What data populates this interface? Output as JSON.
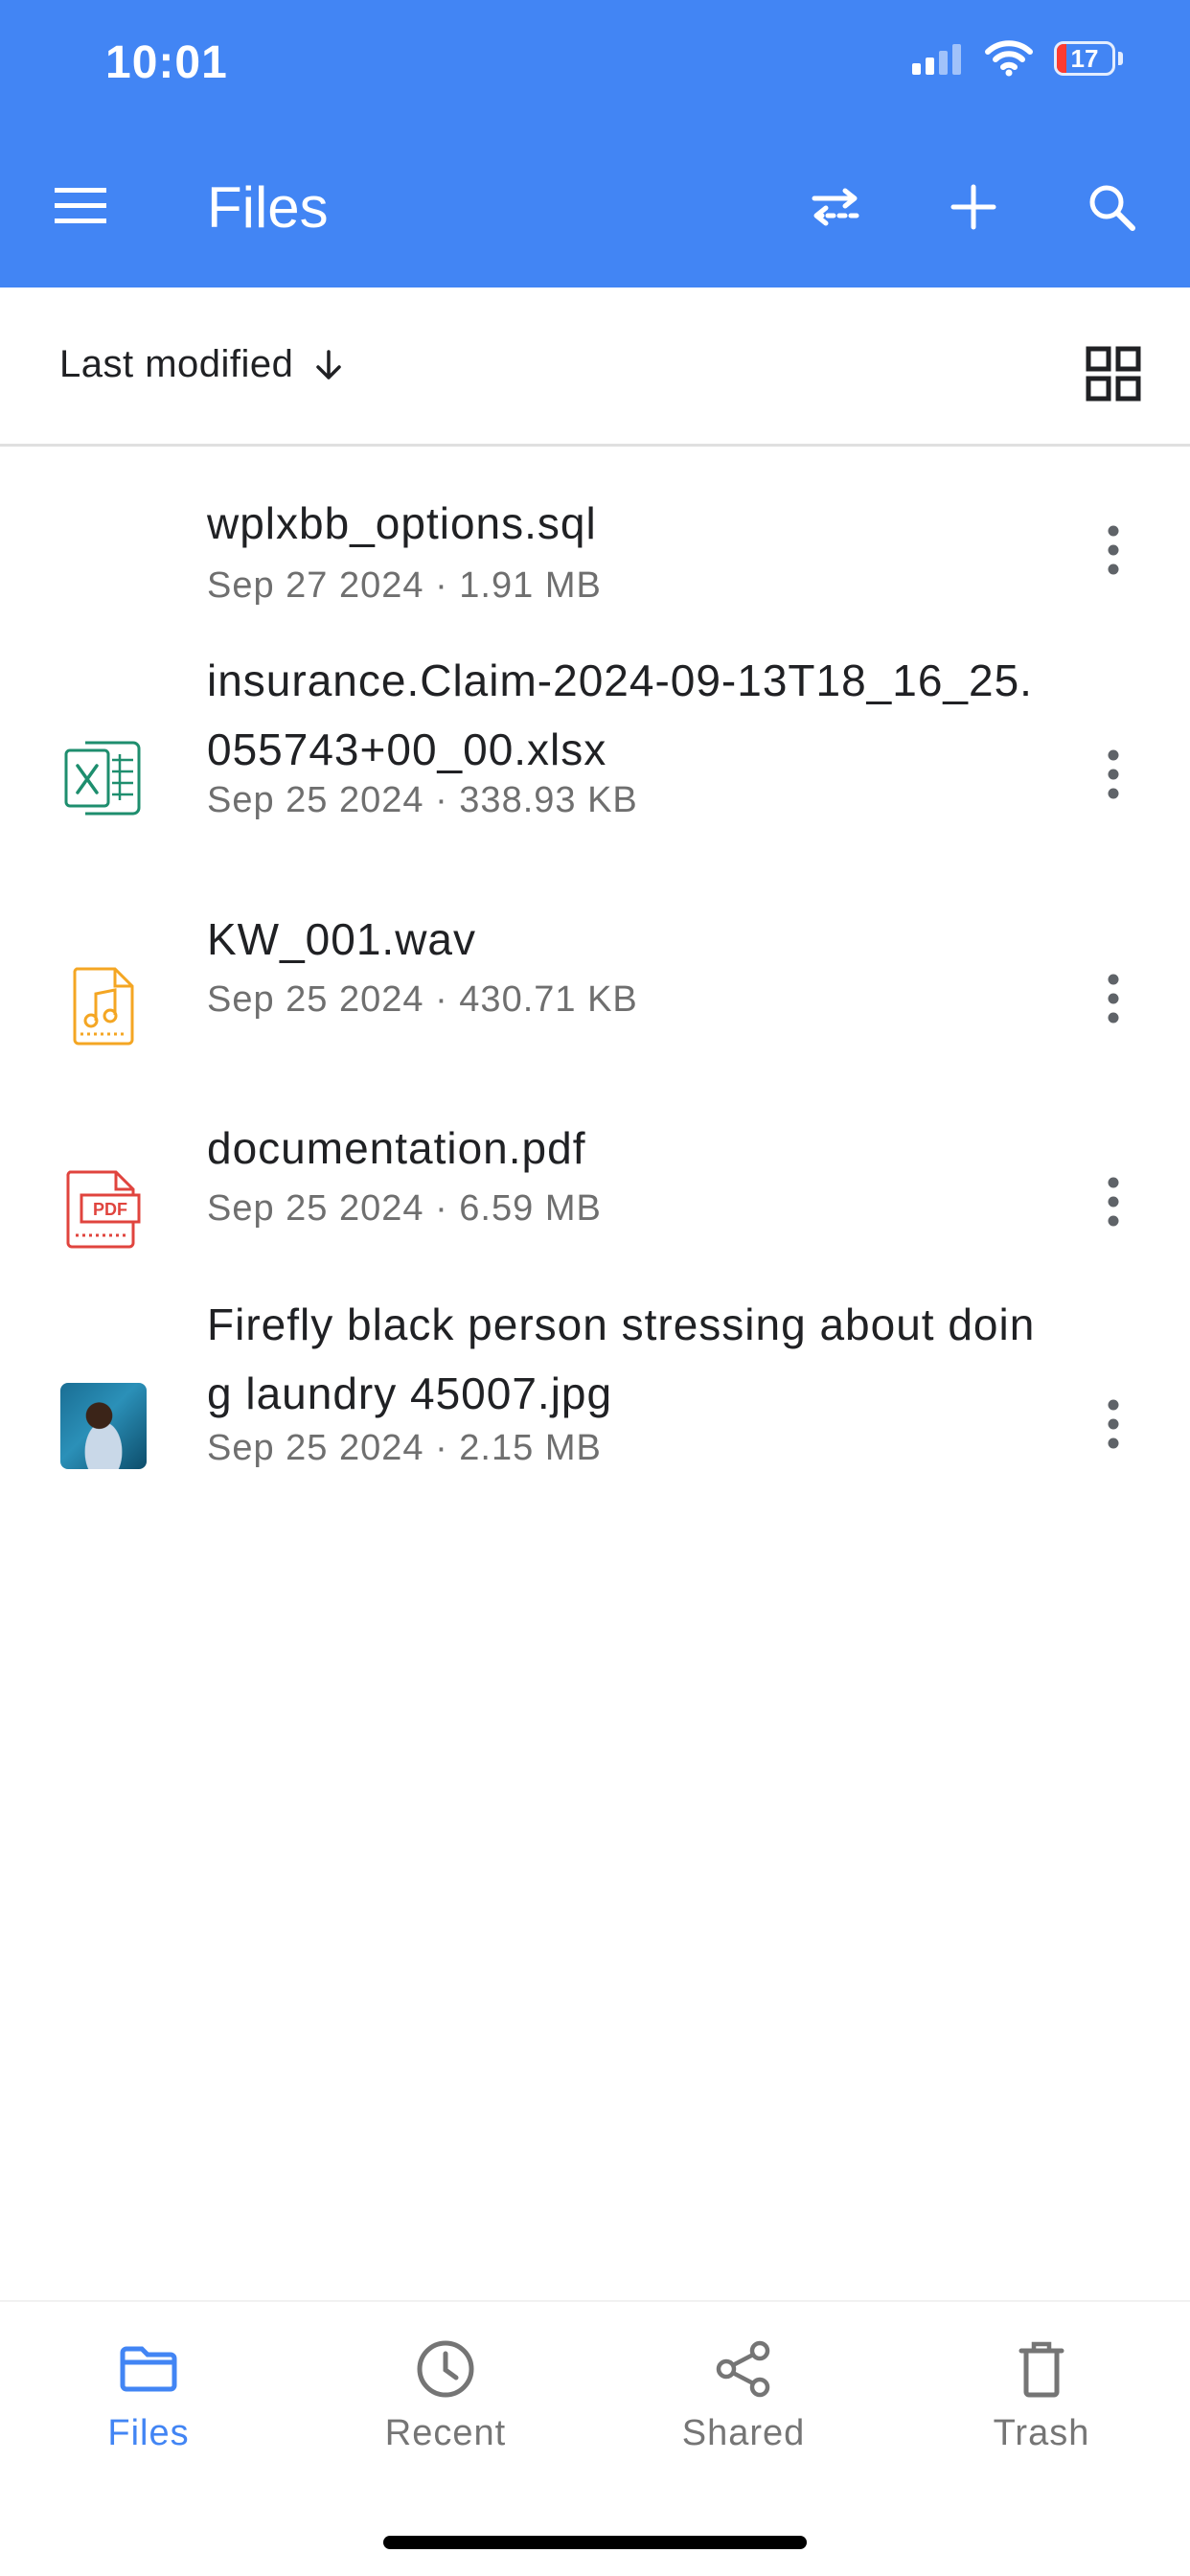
{
  "status_bar": {
    "time": "10:01",
    "battery_level": "17",
    "battery_percent": 17
  },
  "app_bar": {
    "title": "Files",
    "icons": {
      "menu": "menu-icon",
      "sort_switch": "swap-icon",
      "add": "plus-icon",
      "search": "search-icon"
    }
  },
  "sort_bar": {
    "label": "Last modified",
    "direction_icon": "arrow-down-icon",
    "view_icon": "grid-view-icon"
  },
  "files": [
    {
      "name": "wplxbb_options.sql",
      "meta": "Sep 27 2024 · 1.91 MB",
      "icon": "none"
    },
    {
      "name": "insurance.Claim-2024-09-13T18_16_25.055743+00_00.xlsx",
      "meta": "Sep 25 2024 · 338.93 KB",
      "icon": "excel-file-icon"
    },
    {
      "name": "KW_001.wav",
      "meta": "Sep 25 2024 · 430.71 KB",
      "icon": "audio-file-icon"
    },
    {
      "name": "documentation.pdf",
      "meta": "Sep 25 2024 · 6.59 MB",
      "icon": "pdf-file-icon"
    },
    {
      "name": "Firefly black person stressing about doing laundry 45007.jpg",
      "meta": "Sep 25 2024 · 2.15 MB",
      "icon": "image-thumbnail"
    }
  ],
  "pdf_badge": "PDF",
  "bottom_nav": [
    {
      "label": "Files",
      "icon": "folder-icon",
      "active": true
    },
    {
      "label": "Recent",
      "icon": "clock-icon",
      "active": false
    },
    {
      "label": "Shared",
      "icon": "share-icon",
      "active": false
    },
    {
      "label": "Trash",
      "icon": "trash-icon",
      "active": false
    }
  ],
  "colors": {
    "primary": "#4285f4",
    "excel": "#1e8e6e",
    "audio": "#f4a623",
    "pdf": "#e0443e",
    "battery_low": "#ff3b30"
  }
}
